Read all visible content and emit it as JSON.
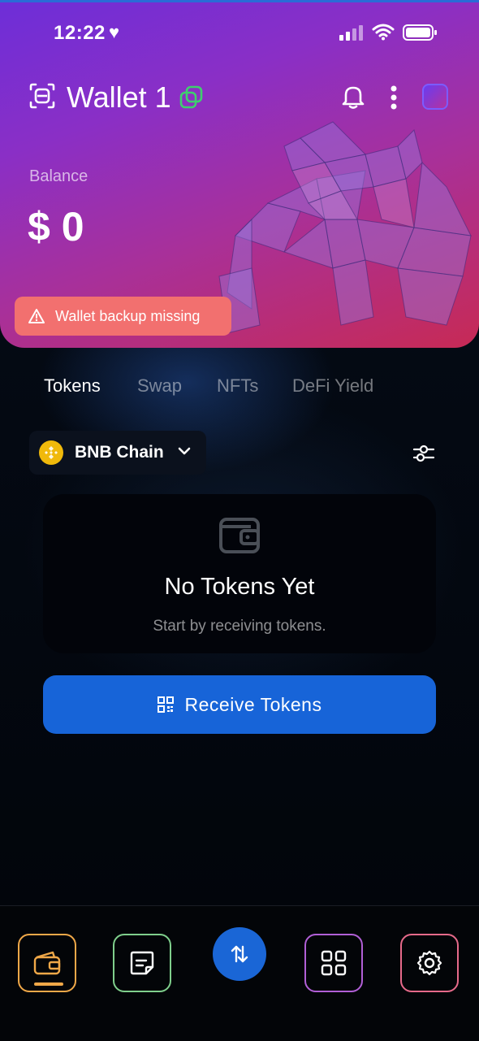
{
  "status_bar": {
    "time": "12:22"
  },
  "header": {
    "wallet_name": "Wallet 1"
  },
  "balance": {
    "label": "Balance",
    "value": "$ 0"
  },
  "alert": {
    "text": "Wallet backup missing"
  },
  "tabs": [
    {
      "label": "Tokens",
      "active": true
    },
    {
      "label": "Swap",
      "active": false
    },
    {
      "label": "NFTs",
      "active": false
    },
    {
      "label": "DeFi Yield",
      "active": false
    }
  ],
  "chain_selector": {
    "selected": "BNB Chain"
  },
  "empty_state": {
    "title": "No Tokens Yet",
    "subtitle": "Start by receiving tokens."
  },
  "receive_button": {
    "label": "Receive Tokens"
  },
  "colors": {
    "hero_start": "#6d2ed8",
    "hero_end": "#c72a55",
    "alert_bg": "#f2706f",
    "primary_button": "#1764d8",
    "nav_wallet": "#f0a848",
    "nav_notes": "#7fcf8c",
    "nav_apps": "#b15fd6",
    "nav_settings": "#e66a8a",
    "bnb_yellow": "#f0b90b"
  },
  "bottom_nav": {
    "items": [
      {
        "name": "wallet",
        "icon": "wallet-icon",
        "active": true
      },
      {
        "name": "notes",
        "icon": "note-icon",
        "active": false
      },
      {
        "name": "swap",
        "icon": "swap-arrows-icon",
        "active": false
      },
      {
        "name": "apps",
        "icon": "grid-icon",
        "active": false
      },
      {
        "name": "settings",
        "icon": "gear-icon",
        "active": false
      }
    ]
  }
}
